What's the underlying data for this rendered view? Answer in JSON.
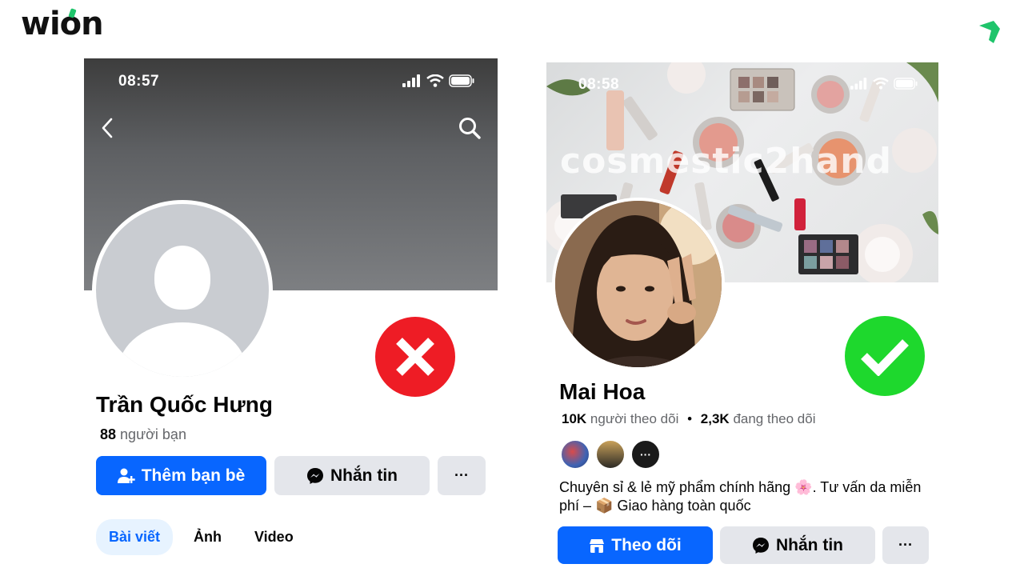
{
  "brand": {
    "logo": "wion",
    "accent": "#1fc46b"
  },
  "left_profile": {
    "status_time": "08:57",
    "name": "Trần Quốc Hưng",
    "friend_count": "88",
    "friend_label": "người bạn",
    "add_friend_label": "Thêm bạn bè",
    "message_label": "Nhắn tin",
    "more_label": "···",
    "tabs": [
      {
        "label": "Bài viết",
        "active": true
      },
      {
        "label": "Ảnh",
        "active": false
      },
      {
        "label": "Video",
        "active": false
      }
    ],
    "verdict_icon": "close-icon",
    "verdict_color": "#ee1c25"
  },
  "right_profile": {
    "status_time": "08:58",
    "cover_watermark": "cosmestic2hand",
    "name": "Mai Hoa",
    "followers_count": "10K",
    "followers_label": "người theo dõi",
    "separator": "•",
    "following_count": "2,3K",
    "following_label": "đang theo dõi",
    "bio": "Chuyên sỉ & lẻ mỹ phẩm chính hãng 🌸. Tư vấn da miễn phí – 📦 Giao hàng toàn quốc",
    "more_dots": "···",
    "follow_label": "Theo dõi",
    "message_label": "Nhắn tin",
    "more_label": "···",
    "verdict_icon": "check-icon",
    "verdict_color": "#1ed82d"
  },
  "colors": {
    "facebook_blue": "#0866ff",
    "button_grey": "#e4e6eb",
    "secondary_text": "#65676b"
  }
}
